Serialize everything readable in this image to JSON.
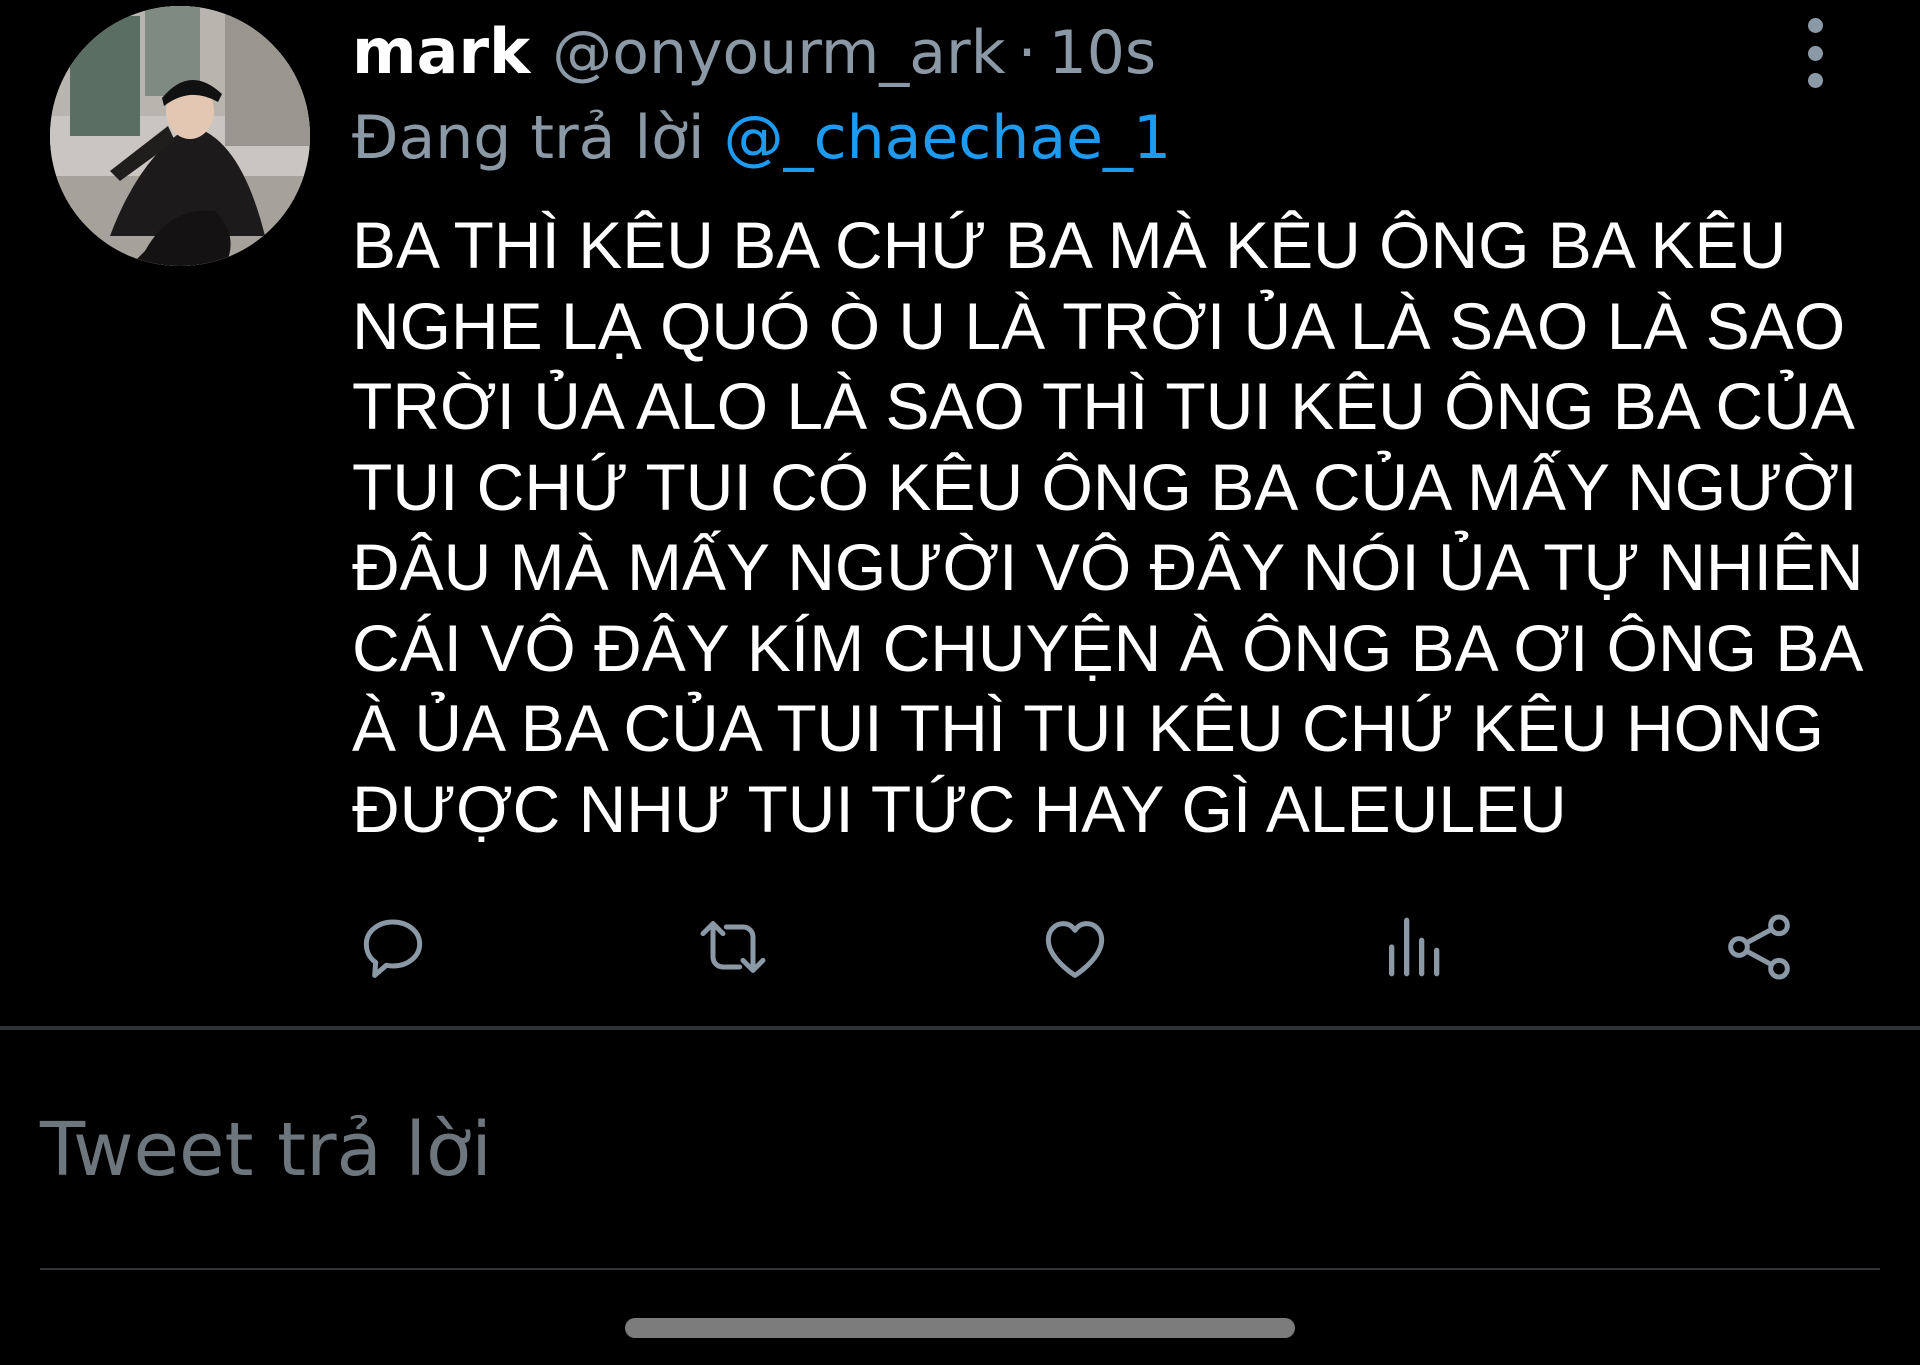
{
  "tweet": {
    "display_name": "mark",
    "handle": "@onyourm_ark",
    "separator": "·",
    "time": "10s",
    "reply_prefix": "Đang trả lời",
    "reply_to": "@_chaechae_1",
    "body": "BA THÌ KÊU BA CHỨ BA MÀ KÊU ÔNG BA KÊU\nNGHE LẠ QUÓ Ò U LÀ TRỜI ỦA LÀ SAO LÀ SAO\nTRỜI ỦA ALO LÀ SAO THÌ TUI KÊU ÔNG BA CỦA\nTUI CHỨ TUI CÓ KÊU ÔNG BA CỦA MẤY NGƯỜI\nĐÂU MÀ MẤY NGƯỜI VÔ ĐÂY NÓI ỦA TỰ NHIÊN\nCÁI VÔ ĐÂY KÍM CHUYỆN À ÔNG BA ƠI ÔNG BA\nÀ ỦA BA CỦA TUI THÌ TUI KÊU CHỨ KÊU HONG\nĐƯỢC NHƯ TUI TỨC HAY GÌ ALEULEU"
  },
  "actions": [
    "reply-icon",
    "retweet-icon",
    "like-icon",
    "analytics-icon",
    "share-icon"
  ],
  "compose": {
    "placeholder": "Tweet trả lời"
  },
  "colors": {
    "background": "#000000",
    "text_primary": "#ffffff",
    "text_secondary": "#8b98a5",
    "accent": "#1d9bf0",
    "divider": "#2f3336"
  }
}
